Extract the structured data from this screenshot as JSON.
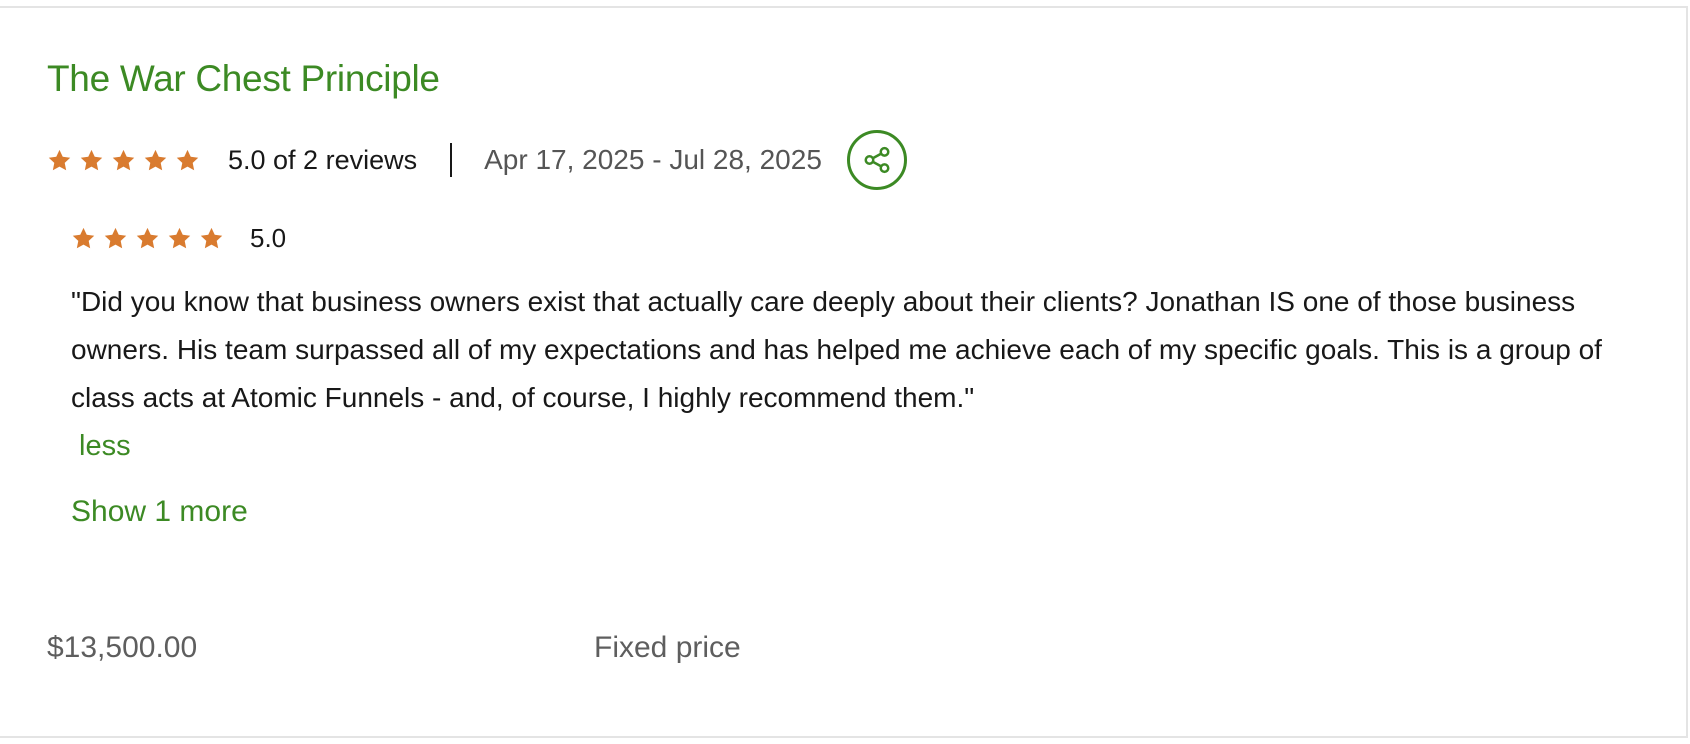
{
  "project": {
    "title": "The War Chest Principle",
    "rating_summary": "5.0 of 2 reviews",
    "rating_value": 5.0,
    "date_range": "Apr 17, 2025 - Jul 28, 2025",
    "share_icon": "share-icon"
  },
  "review": {
    "rating_value": 5.0,
    "score_label": "5.0",
    "text": "\"Did you know that business owners exist that actually care deeply about their clients? Jonathan IS one of those business owners. His team surpassed all of my expectations and has helped me achieve each of my specific goals. This is a group of class acts at Atomic Funnels - and, of course, I highly recommend them.\"",
    "less_label": "less"
  },
  "show_more_label": "Show 1 more",
  "footer": {
    "price": "$13,500.00",
    "price_type": "Fixed price"
  },
  "colors": {
    "accent_green": "#3c8a24",
    "star_orange": "#d97b2f",
    "muted_text": "#5e5e5e"
  }
}
